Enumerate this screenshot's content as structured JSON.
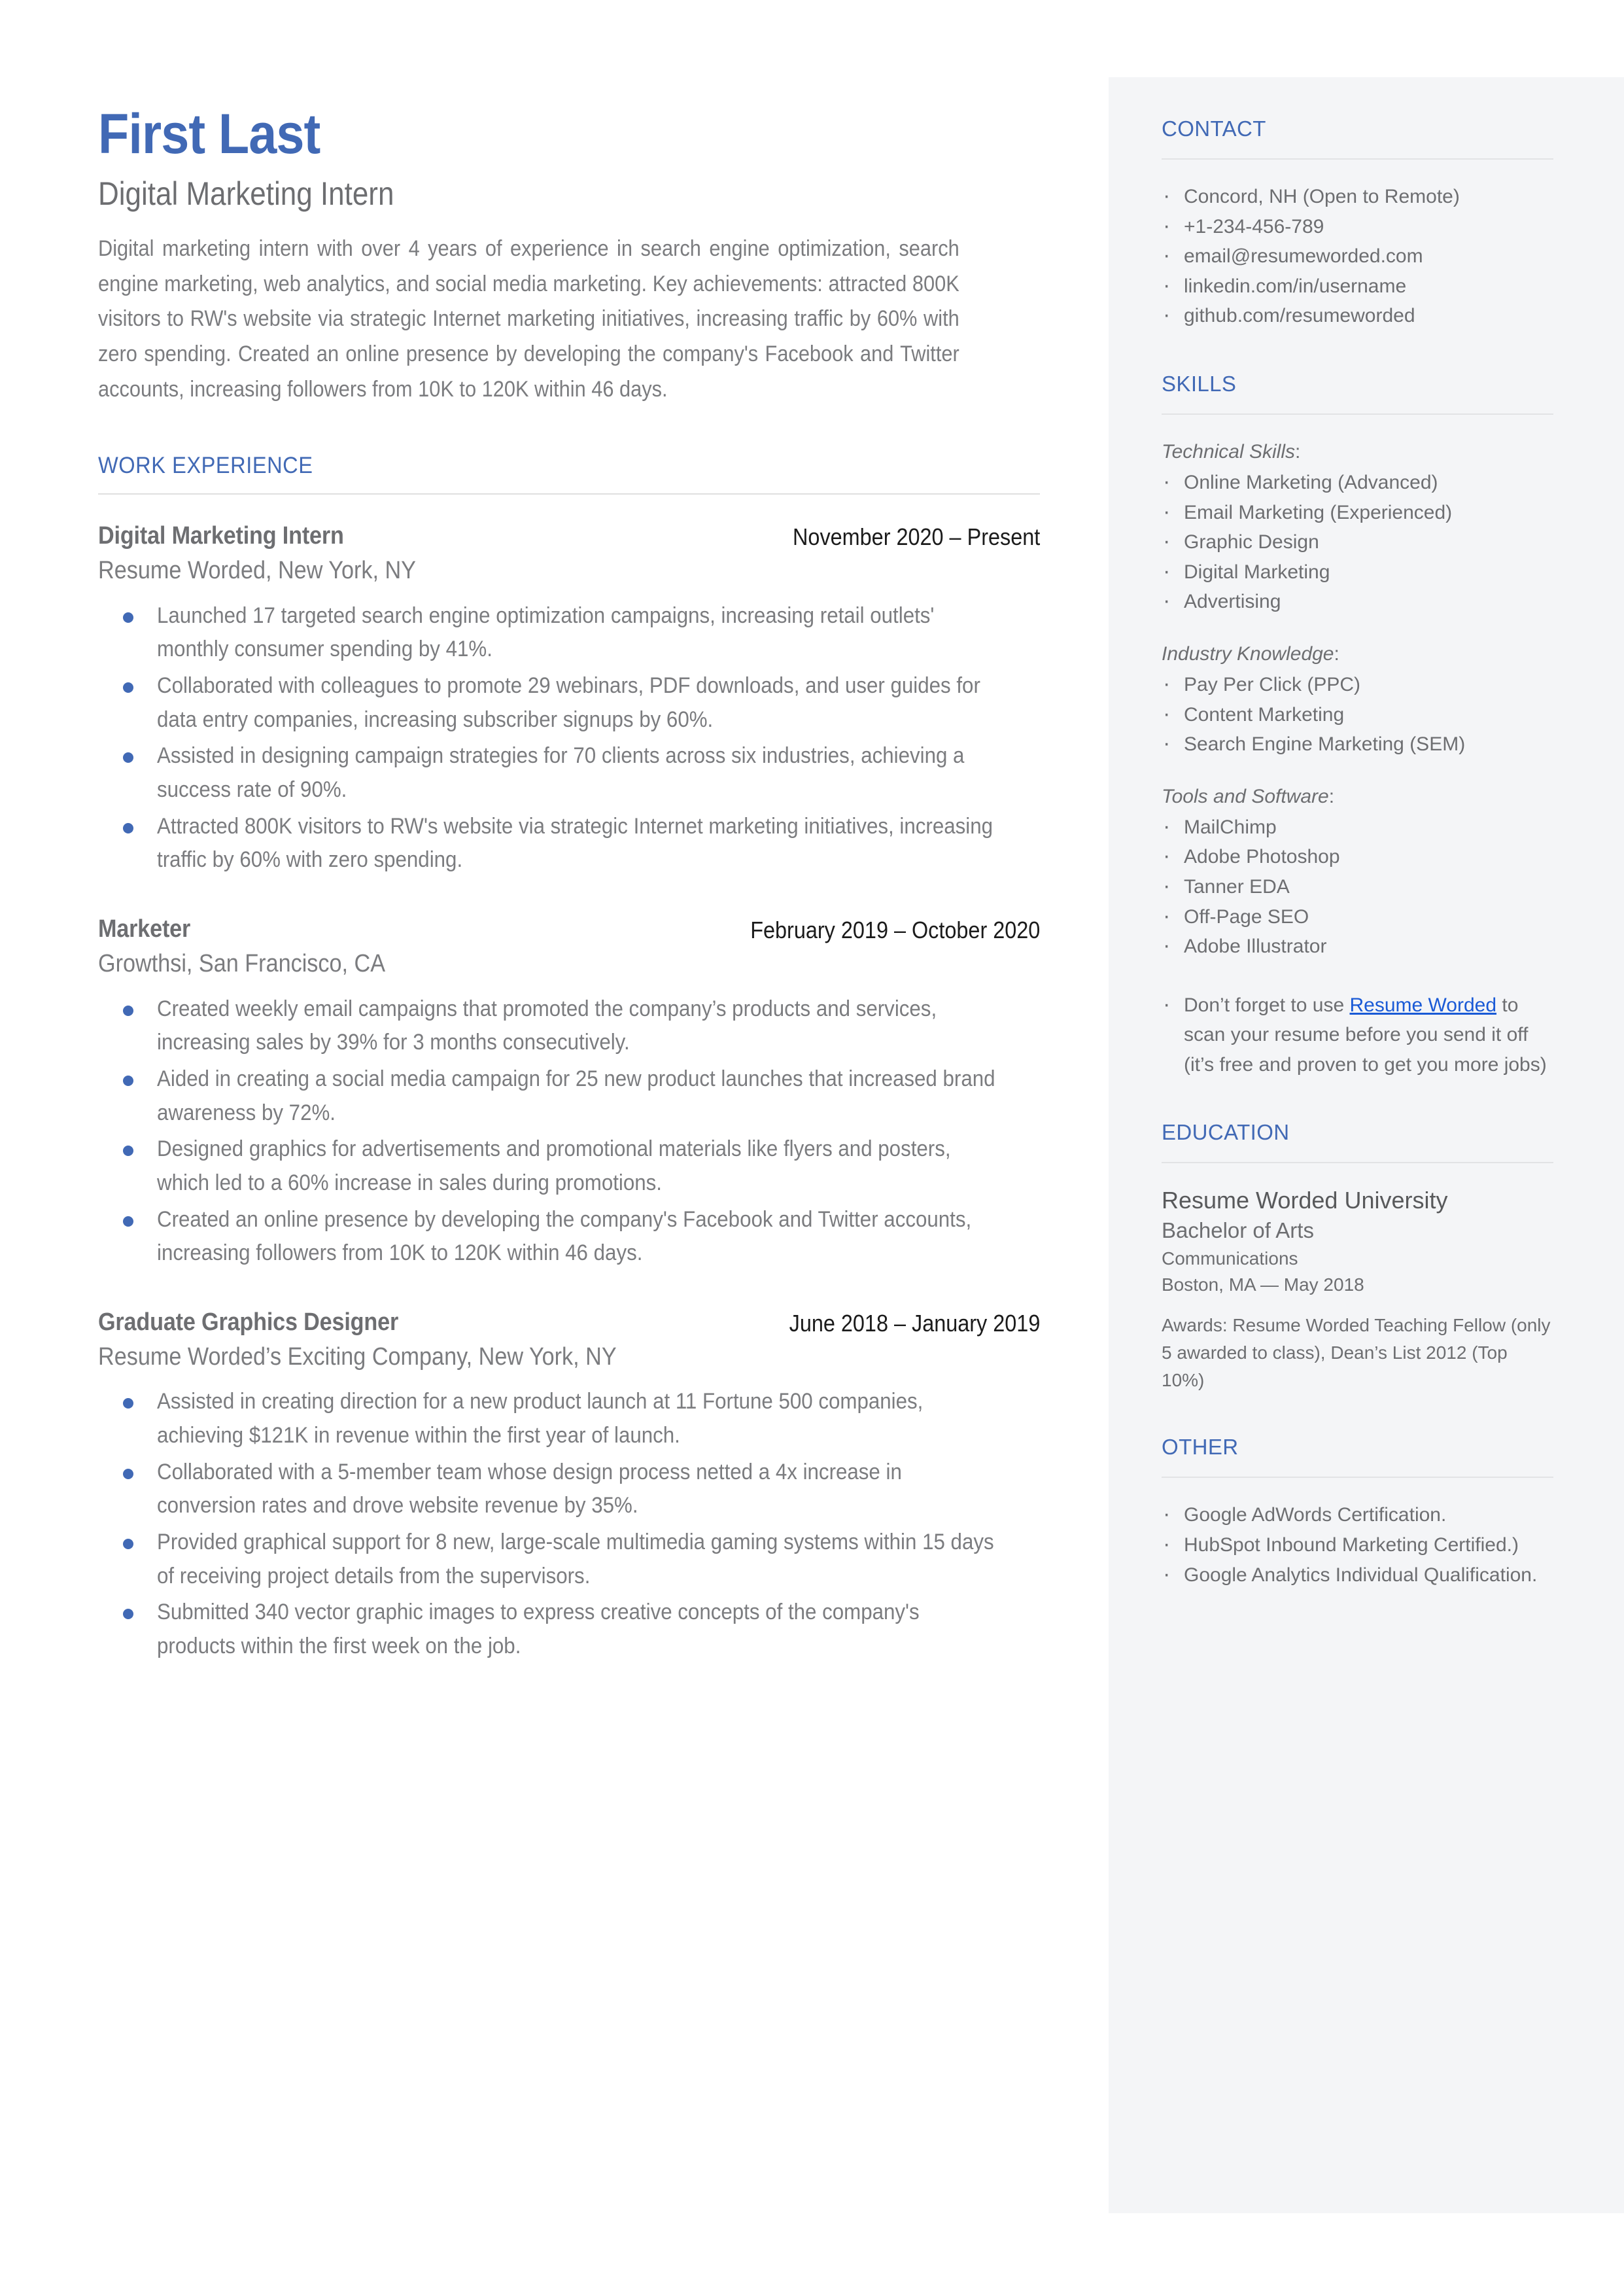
{
  "header": {
    "name": "First Last",
    "headline": "Digital Marketing Intern",
    "summary": "Digital marketing intern with over 4 years of experience in search engine optimization, search engine marketing, web analytics, and social media marketing. Key achievements: attracted 800K visitors to RW's website via strategic Internet marketing initiatives, increasing traffic by 60% with zero spending. Created an online presence by developing the company's Facebook and Twitter accounts, increasing followers from 10K to 120K within 46 days."
  },
  "work": {
    "section_title": "WORK EXPERIENCE",
    "jobs": [
      {
        "title": "Digital Marketing Intern",
        "dates": "November 2020 – Present",
        "company": "Resume Worded, New York, NY",
        "bullets": [
          "Launched 17 targeted search engine optimization campaigns, increasing retail outlets' monthly consumer spending by 41%.",
          "Collaborated with colleagues to promote 29 webinars, PDF downloads, and user guides for data entry companies, increasing subscriber signups by 60%.",
          "Assisted in designing campaign strategies for 70 clients across six industries, achieving a success rate of 90%.",
          "Attracted 800K visitors to RW's website via strategic Internet marketing initiatives, increasing traffic by 60% with zero spending."
        ]
      },
      {
        "title": "Marketer",
        "dates": "February 2019 – October 2020",
        "company": "Growthsi, San Francisco, CA",
        "bullets": [
          "Created weekly email campaigns that promoted the company’s products and services, increasing sales by 39% for 3 months consecutively.",
          "Aided in creating a social media campaign for 25 new product launches that increased brand awareness by 72%.",
          "Designed graphics for advertisements and promotional materials like flyers and posters, which led to a 60% increase in sales during promotions.",
          "Created an online presence by developing the company's Facebook and Twitter accounts, increasing followers from 10K to 120K within 46 days."
        ]
      },
      {
        "title": "Graduate Graphics Designer",
        "dates": "June 2018 – January 2019",
        "company": "Resume Worded’s Exciting Company, New York, NY",
        "bullets": [
          "Assisted in creating direction for a new product launch at 11 Fortune 500 companies, achieving $121K in revenue within the first year of launch.",
          "Collaborated with a 5-member team whose design process netted a 4x increase in conversion rates and drove website revenue by 35%.",
          "Provided graphical support for 8 new, large-scale multimedia gaming systems within 15 days of receiving project details from the supervisors.",
          "Submitted 340 vector graphic images to express creative concepts of the company's products within the first week on the job."
        ]
      }
    ]
  },
  "sidebar": {
    "contact": {
      "title": "CONTACT",
      "items": [
        "Concord, NH (Open to Remote)",
        "+1-234-456-789",
        "email@resumeworded.com",
        "linkedin.com/in/username",
        "github.com/resumeworded"
      ]
    },
    "skills": {
      "title": "SKILLS",
      "groups": [
        {
          "label": "Technical Skills",
          "items": [
            "Online Marketing (Advanced)",
            "Email Marketing (Experienced)",
            "Graphic Design",
            "Digital Marketing",
            "Advertising"
          ]
        },
        {
          "label": "Industry Knowledge",
          "items": [
            "Pay Per Click (PPC)",
            "Content Marketing",
            "Search Engine Marketing (SEM)"
          ]
        },
        {
          "label": "Tools and Software",
          "items": [
            "MailChimp",
            "Adobe Photoshop",
            "Tanner EDA",
            "Off-Page SEO",
            "Adobe Illustrator"
          ]
        }
      ],
      "note_prefix": "Don’t forget to use ",
      "note_link": "Resume Worded",
      "note_suffix": " to scan your resume before you send it off (it’s free and proven to get you more jobs)"
    },
    "education": {
      "title": "EDUCATION",
      "school": "Resume Worded University",
      "degree": "Bachelor of Arts",
      "field": "Communications",
      "location": "Boston, MA — May 2018",
      "awards": "Awards: Resume Worded Teaching Fellow (only 5 awarded to class), Dean’s List 2012 (Top 10%)"
    },
    "other": {
      "title": "OTHER",
      "items": [
        "Google AdWords Certification.",
        "HubSpot Inbound Marketing Certified.)",
        "Google Analytics Individual Qualification."
      ]
    }
  },
  "theme": {
    "accent_blue": "#4169b5",
    "link_blue": "#1a5ad6",
    "body_gray": "#7b7c7f",
    "panel_bg": "#f4f5f7",
    "rule_gray": "#e0e0e0"
  }
}
